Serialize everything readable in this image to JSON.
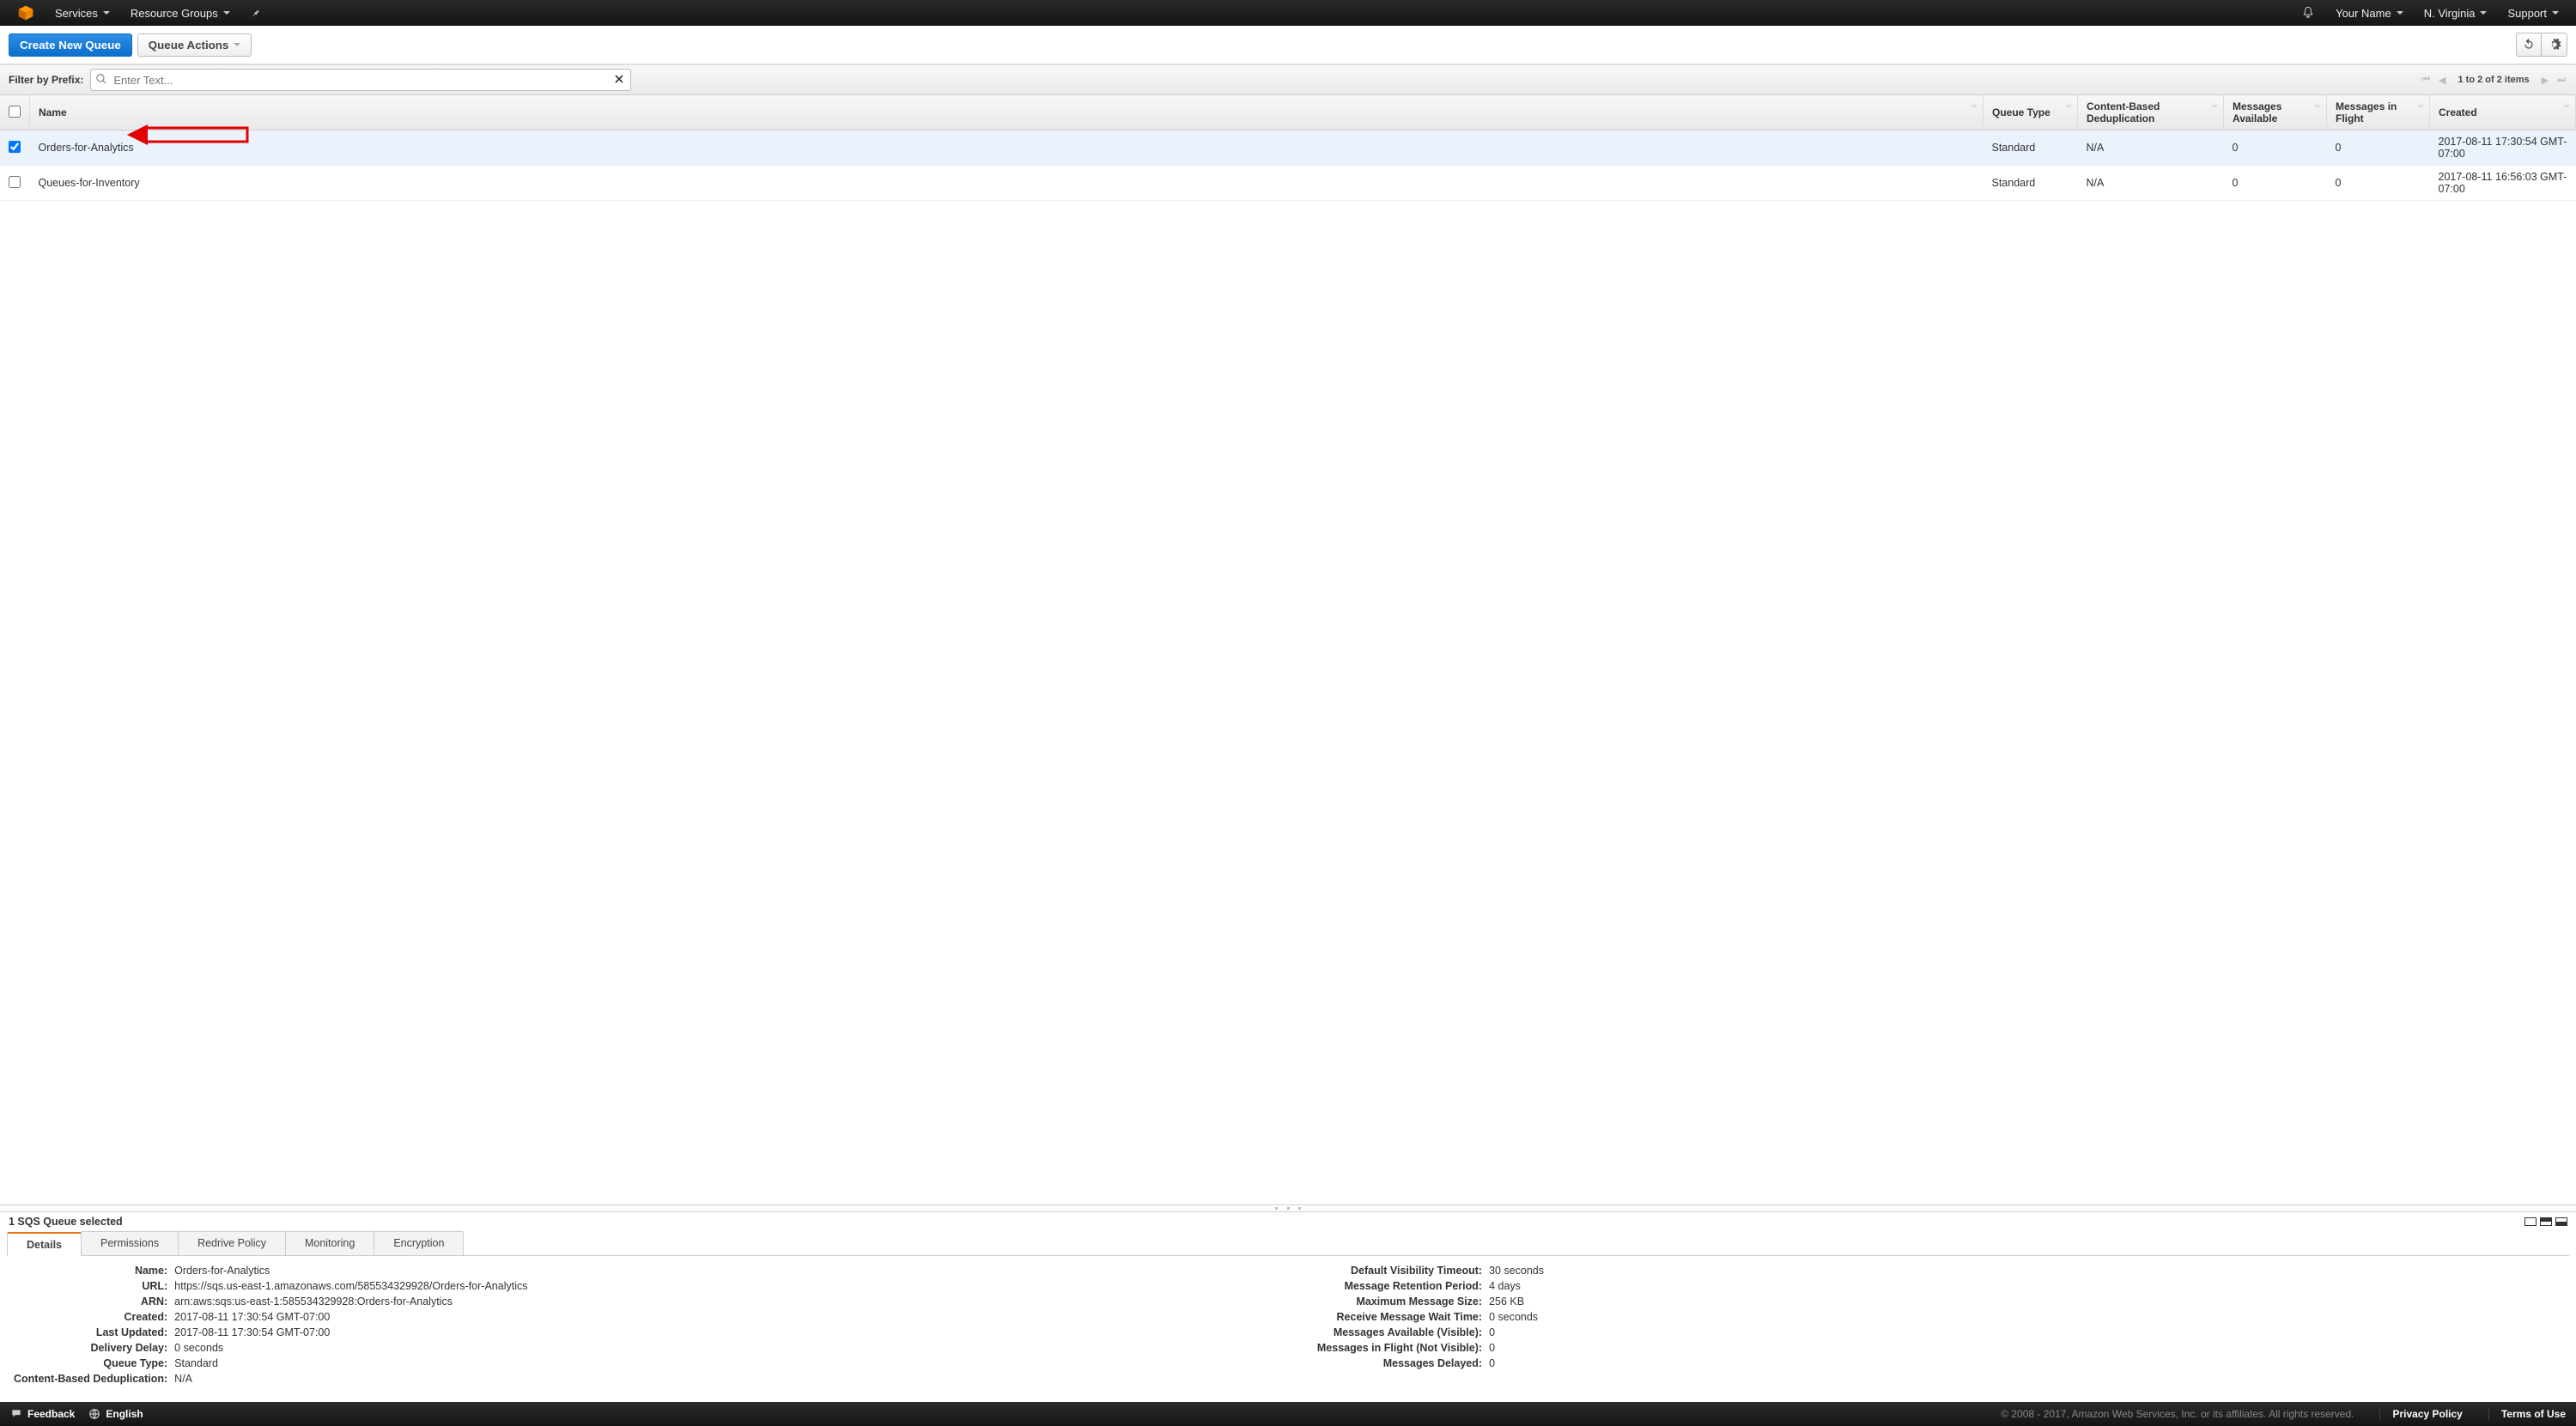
{
  "topnav": {
    "services": "Services",
    "resource_groups": "Resource Groups",
    "user": "Your Name",
    "region": "N. Virginia",
    "support": "Support"
  },
  "toolbar": {
    "create": "Create New Queue",
    "queue_actions": "Queue Actions"
  },
  "filter": {
    "label": "Filter by Prefix:",
    "placeholder": "Enter Text...",
    "pager_text": "1 to 2 of 2 items"
  },
  "columns": {
    "name": "Name",
    "type": "Queue Type",
    "cbd": "Content-Based Deduplication",
    "avail": "Messages Available",
    "inflight": "Messages in Flight",
    "created": "Created"
  },
  "rows": [
    {
      "selected": true,
      "name": "Orders-for-Analytics",
      "type": "Standard",
      "cbd": "N/A",
      "avail": "0",
      "inflight": "0",
      "created": "2017-08-11 17:30:54 GMT-07:00"
    },
    {
      "selected": false,
      "name": "Queues-for-Inventory",
      "type": "Standard",
      "cbd": "N/A",
      "avail": "0",
      "inflight": "0",
      "created": "2017-08-11 16:56:03 GMT-07:00"
    }
  ],
  "selection_title": "1 SQS Queue selected",
  "tabs": {
    "details": "Details",
    "permissions": "Permissions",
    "redrive": "Redrive Policy",
    "monitoring": "Monitoring",
    "encryption": "Encryption"
  },
  "details_left": {
    "Name": "Orders-for-Analytics",
    "URL": "https://sqs.us-east-1.amazonaws.com/585534329928/Orders-for-Analytics",
    "ARN": "arn:aws:sqs:us-east-1:585534329928:Orders-for-Analytics",
    "Created": "2017-08-11 17:30:54 GMT-07:00",
    "Last_Updated": "2017-08-11 17:30:54 GMT-07:00",
    "Delivery_Delay": "0 seconds",
    "Queue_Type": "Standard",
    "Content_Based_Deduplication": "N/A"
  },
  "details_right": {
    "Default_Visibility_Timeout": "30 seconds",
    "Message_Retention_Period": "4 days",
    "Maximum_Message_Size": "256 KB",
    "Receive_Message_Wait_Time": "0 seconds",
    "Messages_Available_Visible": "0",
    "Messages_in_Flight_Not_Visible": "0",
    "Messages_Delayed": "0"
  },
  "details_labels_left": {
    "Name": "Name:",
    "URL": "URL:",
    "ARN": "ARN:",
    "Created": "Created:",
    "Last_Updated": "Last Updated:",
    "Delivery_Delay": "Delivery Delay:",
    "Queue_Type": "Queue Type:",
    "Content_Based_Deduplication": "Content-Based Deduplication:"
  },
  "details_labels_right": {
    "Default_Visibility_Timeout": "Default Visibility Timeout:",
    "Message_Retention_Period": "Message Retention Period:",
    "Maximum_Message_Size": "Maximum Message Size:",
    "Receive_Message_Wait_Time": "Receive Message Wait Time:",
    "Messages_Available_Visible": "Messages Available (Visible):",
    "Messages_in_Flight_Not_Visible": "Messages in Flight (Not Visible):",
    "Messages_Delayed": "Messages Delayed:"
  },
  "footer": {
    "feedback": "Feedback",
    "language": "English",
    "copyright": "© 2008 - 2017, Amazon Web Services, Inc. or its affiliates. All rights reserved.",
    "privacy": "Privacy Policy",
    "terms": "Terms of Use"
  }
}
